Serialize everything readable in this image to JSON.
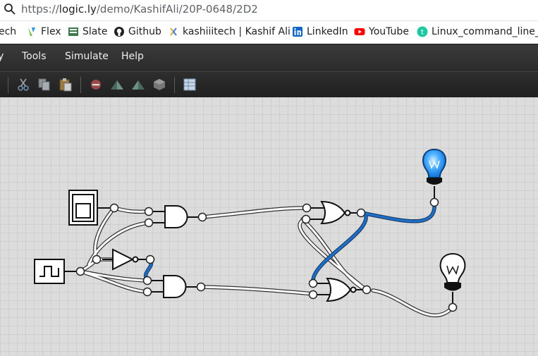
{
  "browser": {
    "url_prefix": "https://",
    "url_domain": "logic.ly",
    "url_path": "/demo/KashifAli/20P-0648/2D2"
  },
  "bookmarks": [
    {
      "label": "ech",
      "icon": "truncated-bookmark"
    },
    {
      "label": "Flex",
      "icon": "flex-icon"
    },
    {
      "label": "Slate",
      "icon": "slate-icon"
    },
    {
      "label": "Github",
      "icon": "github-icon"
    },
    {
      "label": "kashiiitech | Kashif Ali",
      "icon": "kashiiitech-icon"
    },
    {
      "label": "LinkedIn",
      "icon": "linkedin-icon"
    },
    {
      "label": "YouTube",
      "icon": "youtube-icon"
    },
    {
      "label": "Linux_command_line_...",
      "icon": "linux-icon"
    }
  ],
  "menu": {
    "edge_item": "y",
    "tools": "Tools",
    "simulate": "Simulate",
    "help": "Help"
  },
  "toolbar": {
    "icons": [
      "cut-icon",
      "copy-icon",
      "paste-icon",
      "delete-icon",
      "rotate-left-icon",
      "rotate-right-icon",
      "component-icon",
      "table-icon"
    ]
  },
  "circuit": {
    "components": [
      {
        "name": "toggle-switch",
        "state": "off"
      },
      {
        "name": "clock",
        "state": "low"
      },
      {
        "name": "not-gate"
      },
      {
        "name": "and-gate-top"
      },
      {
        "name": "and-gate-bottom"
      },
      {
        "name": "nor-gate-top",
        "output": "on"
      },
      {
        "name": "nor-gate-bottom",
        "output": "off"
      },
      {
        "name": "light-bulb-top",
        "state": "on"
      },
      {
        "name": "light-bulb-bottom",
        "state": "off"
      }
    ],
    "colors": {
      "wire_on": "#1f6fc9",
      "wire_off": "#ffffff",
      "bulb_on": "#2b9fff",
      "canvas": "#dcdcdc"
    }
  }
}
